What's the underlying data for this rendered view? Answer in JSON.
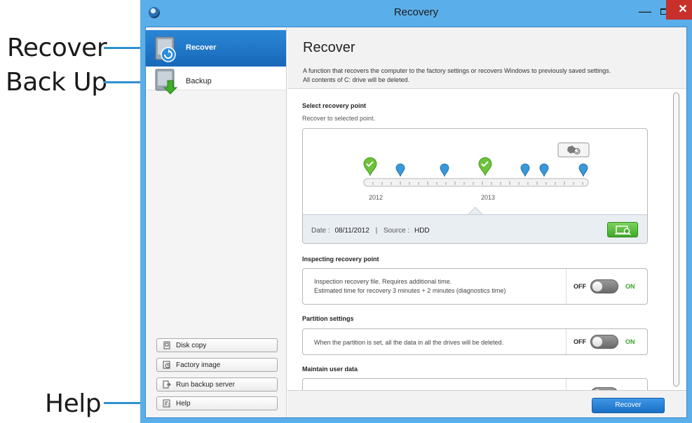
{
  "callouts": {
    "recover": "Recover",
    "backup": "Back Up",
    "help": "Help",
    "accent": "#2f8fd0"
  },
  "window": {
    "title": "Recovery",
    "minimize_glyph": "—",
    "maximize_glyph": "",
    "close_glyph": "✕"
  },
  "sidebar": {
    "items": [
      {
        "label": "Recover",
        "icon": "recover-disk-icon",
        "active": true
      },
      {
        "label": "Backup",
        "icon": "backup-disk-icon",
        "active": false
      }
    ],
    "buttons": [
      {
        "label": "Disk copy",
        "icon": "disk-copy-icon"
      },
      {
        "label": "Factory image",
        "icon": "factory-image-icon"
      },
      {
        "label": "Run backup server",
        "icon": "backup-server-icon"
      },
      {
        "label": "Help",
        "icon": "help-icon"
      }
    ]
  },
  "main": {
    "title": "Recover",
    "description_line1": "A function that recovers the computer to the factory settings or recovers Windows to previously saved settings.",
    "description_line2": "All contents of C: drive will be deleted.",
    "select_point": {
      "title": "Select recovery point",
      "subtitle": "Recover to selected point.",
      "year_labels": [
        "2012",
        "2013"
      ],
      "date_label": "Date :",
      "date_value": "08/11/2012",
      "source_label": "Source :",
      "source_value": "HDD"
    },
    "inspecting": {
      "title": "Inspecting recovery point",
      "line1": "Inspection recovery file. Requires additional time.",
      "line2": "Estimated time for recovery 3 minutes + 2 minutes (diagnostics time)",
      "off": "OFF",
      "on": "ON",
      "state": "off"
    },
    "partition": {
      "title": "Partition settings",
      "line1": "When the partition is set, all the data in all the drives will be deleted.",
      "off": "OFF",
      "on": "ON",
      "state": "off"
    },
    "maintain": {
      "title": "Maintain user data"
    },
    "recover_button": "Recover"
  },
  "colors": {
    "titlebar": "#5aaee9",
    "active_item": "#1f77c9",
    "close_button": "#c7302b",
    "green_check": "#6cc23a",
    "blue_pin": "#3a98d8"
  }
}
